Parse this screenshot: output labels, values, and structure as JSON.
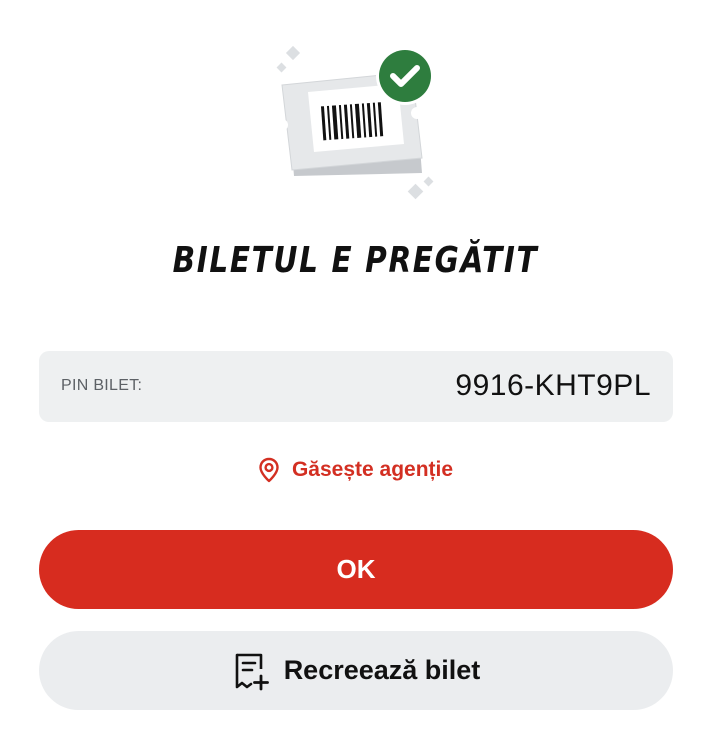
{
  "dialog": {
    "title": "BILETUL E PREGĂTIT",
    "pin_label": "PIN BILET:",
    "pin_value": "9916-KHT9PL",
    "find_agency_label": "Găsește agenție",
    "ok_label": "OK",
    "recreate_label": "Recreează bilet"
  },
  "icons": {
    "illustration": "ticket-with-checkmark-icon",
    "location": "location-pin-icon",
    "recreate": "receipt-add-icon"
  },
  "colors": {
    "accent_red": "#d72c1f",
    "success_green": "#2e7d3e",
    "pin_box_bg": "#eef0f1",
    "secondary_button_bg": "#ebedef"
  }
}
